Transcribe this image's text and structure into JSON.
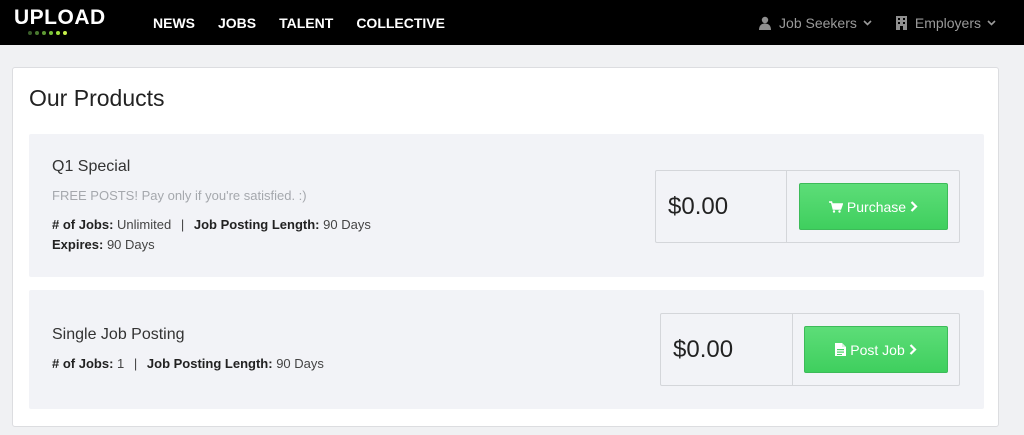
{
  "navbar": {
    "logo": "UPLOAD",
    "logo_dot_colors": [
      "#3a5d2a",
      "#4a7a30",
      "#5e9a34",
      "#79c13a",
      "#9ee03c",
      "#c6f04a"
    ],
    "links": [
      "NEWS",
      "JOBS",
      "TALENT",
      "COLLECTIVE"
    ],
    "menus": {
      "job_seekers": "Job Seekers",
      "employers": "Employers"
    }
  },
  "page": {
    "title": "Our Products"
  },
  "products": [
    {
      "name": "Q1 Special",
      "description": "FREE POSTS! Pay only if you're satisfied. :)",
      "jobs_label": "# of Jobs:",
      "jobs_value": "Unlimited",
      "length_label": "Job Posting Length:",
      "length_value": "90 Days",
      "expires_label": "Expires:",
      "expires_value": "90 Days",
      "price": "$0.00",
      "button_label": "Purchase",
      "button_icon": "shopping-cart-icon"
    },
    {
      "name": "Single Job Posting",
      "jobs_label": "# of Jobs:",
      "jobs_value": "1",
      "length_label": "Job Posting Length:",
      "length_value": "90 Days",
      "price": "$0.00",
      "button_label": "Post Job",
      "button_icon": "document-icon"
    }
  ],
  "colors": {
    "navbar_bg": "#000000",
    "accent_green": "#4cd86a",
    "card_bg": "#f2f3f7"
  }
}
